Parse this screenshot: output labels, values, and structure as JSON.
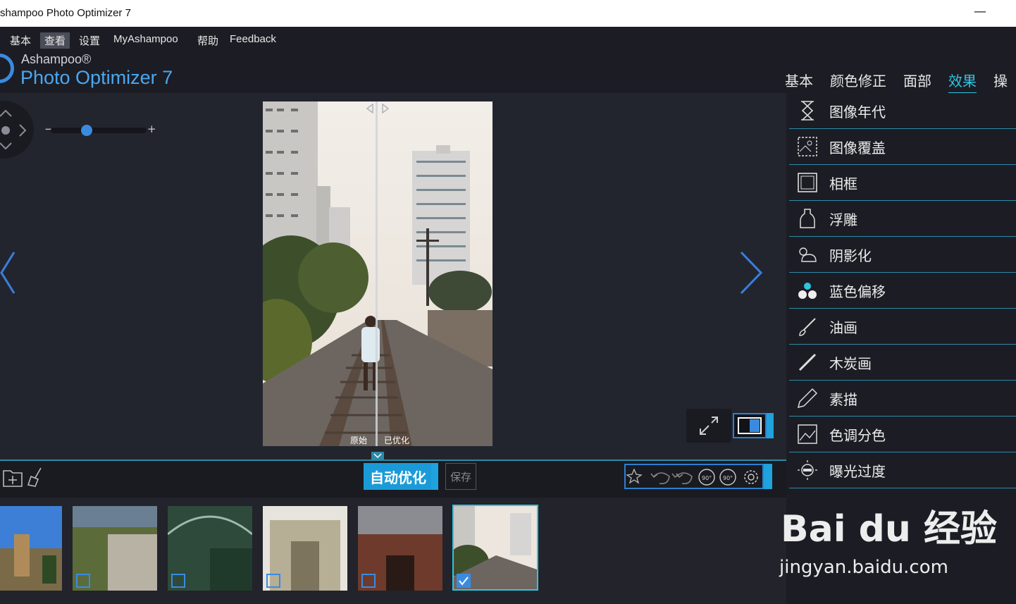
{
  "window": {
    "title": "shampoo Photo Optimizer 7",
    "minimize": "—",
    "close": "✕"
  },
  "menubar": {
    "items": [
      {
        "label": "基本"
      },
      {
        "label": "查看"
      },
      {
        "label": "设置"
      },
      {
        "label": "MyAshampoo"
      },
      {
        "label": "帮助"
      },
      {
        "label": "Feedback"
      }
    ]
  },
  "brand": {
    "line1": "Ashampoo®",
    "line2": "Photo Optimizer 7"
  },
  "tabs": [
    {
      "label": "基本"
    },
    {
      "label": "颜色修正"
    },
    {
      "label": "面部"
    },
    {
      "label": "效果"
    },
    {
      "label": "操作"
    }
  ],
  "viewer": {
    "zoom_minus": "−",
    "zoom_plus": "+",
    "zoom_level": 0.4,
    "compare_left": "原始",
    "compare_right": "已优化"
  },
  "effects": [
    {
      "label": "图像年代",
      "icon": "hourglass-icon"
    },
    {
      "label": "图像覆盖",
      "icon": "image-overlay-icon"
    },
    {
      "label": "相框",
      "icon": "frame-icon"
    },
    {
      "label": "浮雕",
      "icon": "emboss-icon"
    },
    {
      "label": "阴影化",
      "icon": "shadow-icon"
    },
    {
      "label": "蓝色偏移",
      "icon": "blue-shift-icon"
    },
    {
      "label": "油画",
      "icon": "oil-brush-icon"
    },
    {
      "label": "木炭画",
      "icon": "charcoal-icon"
    },
    {
      "label": "素描",
      "icon": "pencil-icon"
    },
    {
      "label": "色调分色",
      "icon": "posterize-icon"
    },
    {
      "label": "曝光过度",
      "icon": "overexposure-icon"
    }
  ],
  "toolbar": {
    "auto_label": "自动优化",
    "save_label": "保存",
    "rotate_left": "90°",
    "rotate_right": "90°"
  },
  "filmstrip": {
    "selected_index": 5,
    "count": 6
  },
  "watermark": {
    "line1": "Bai du 经验",
    "line2": "jingyan.baidu.com"
  },
  "colors": {
    "accent": "#30c4e0",
    "button": "#1a9bd8",
    "bg": "#23252e",
    "panel": "#1c1d24"
  }
}
